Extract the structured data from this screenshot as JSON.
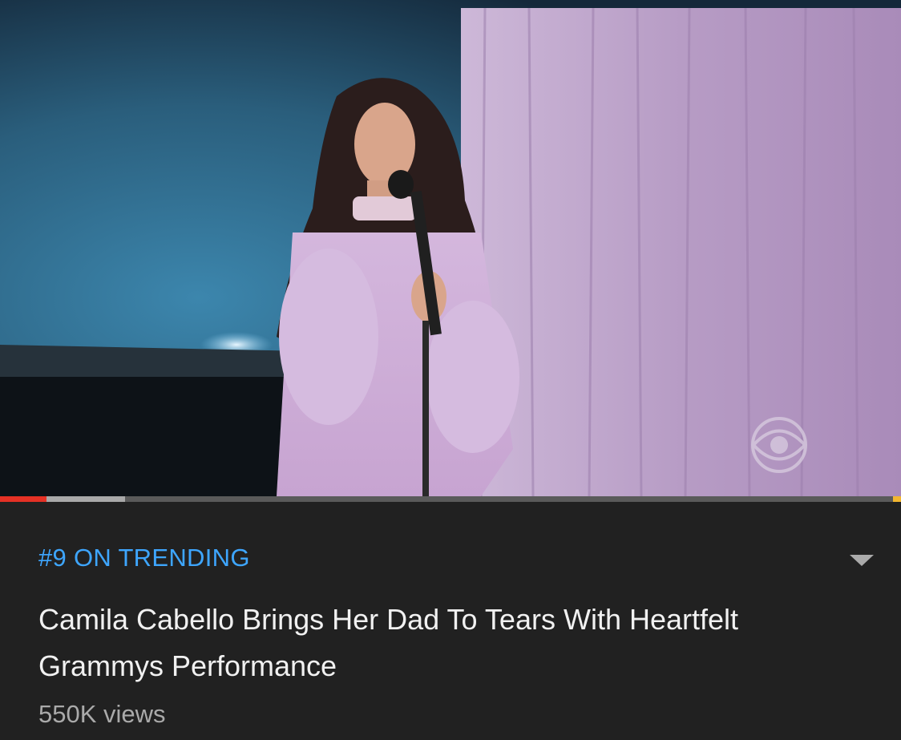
{
  "video": {
    "thumbnail": "video-frame",
    "logo": "cbs-eye-logo",
    "progress": {
      "played_percent": 5.2,
      "buffered_percent": 13.9
    },
    "colors": {
      "played": "#e53125",
      "buffered": "#a9a9a9",
      "track": "#5a5a5a",
      "marker": "#f2b630"
    }
  },
  "info": {
    "trending_label": "#9 ON TRENDING",
    "title": "Camila Cabello Brings Her Dad To Tears With Heartfelt Grammys Performance",
    "views": "550K views",
    "expand_icon": "chevron-down-icon",
    "colors": {
      "background": "#212121",
      "trending": "#3ea6ff",
      "title": "#f1f1f1",
      "views": "#aaaaaa"
    }
  }
}
